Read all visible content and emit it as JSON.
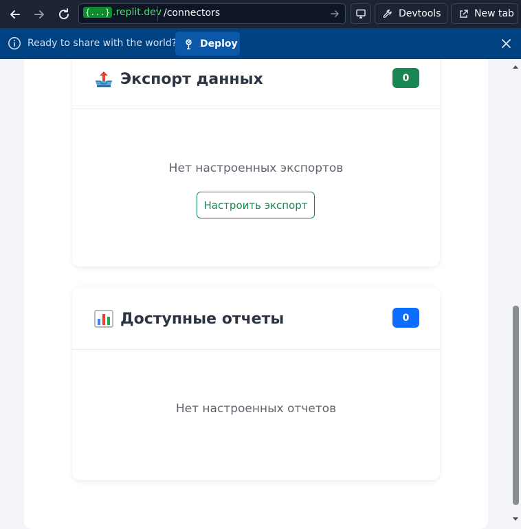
{
  "browser": {
    "url_badge": "{...}",
    "url_domain": ".replit.dev",
    "url_path": "/connectors",
    "devtools_label": "Devtools",
    "newtab_label": "New tab"
  },
  "banner": {
    "text": "Ready to share with the world?",
    "deploy_label": "Deploy"
  },
  "export_card": {
    "title": "Экспорт данных",
    "icon": "outbox-tray-emoji",
    "count": "0",
    "empty_text": "Нет настроенных экспортов",
    "button_label": "Настроить экспорт",
    "badge_color": "#198754"
  },
  "reports_card": {
    "title": "Доступные отчеты",
    "icon": "bar-chart-emoji",
    "count": "0",
    "empty_text": "Нет настроенных отчетов",
    "badge_color": "#0d6efd"
  }
}
